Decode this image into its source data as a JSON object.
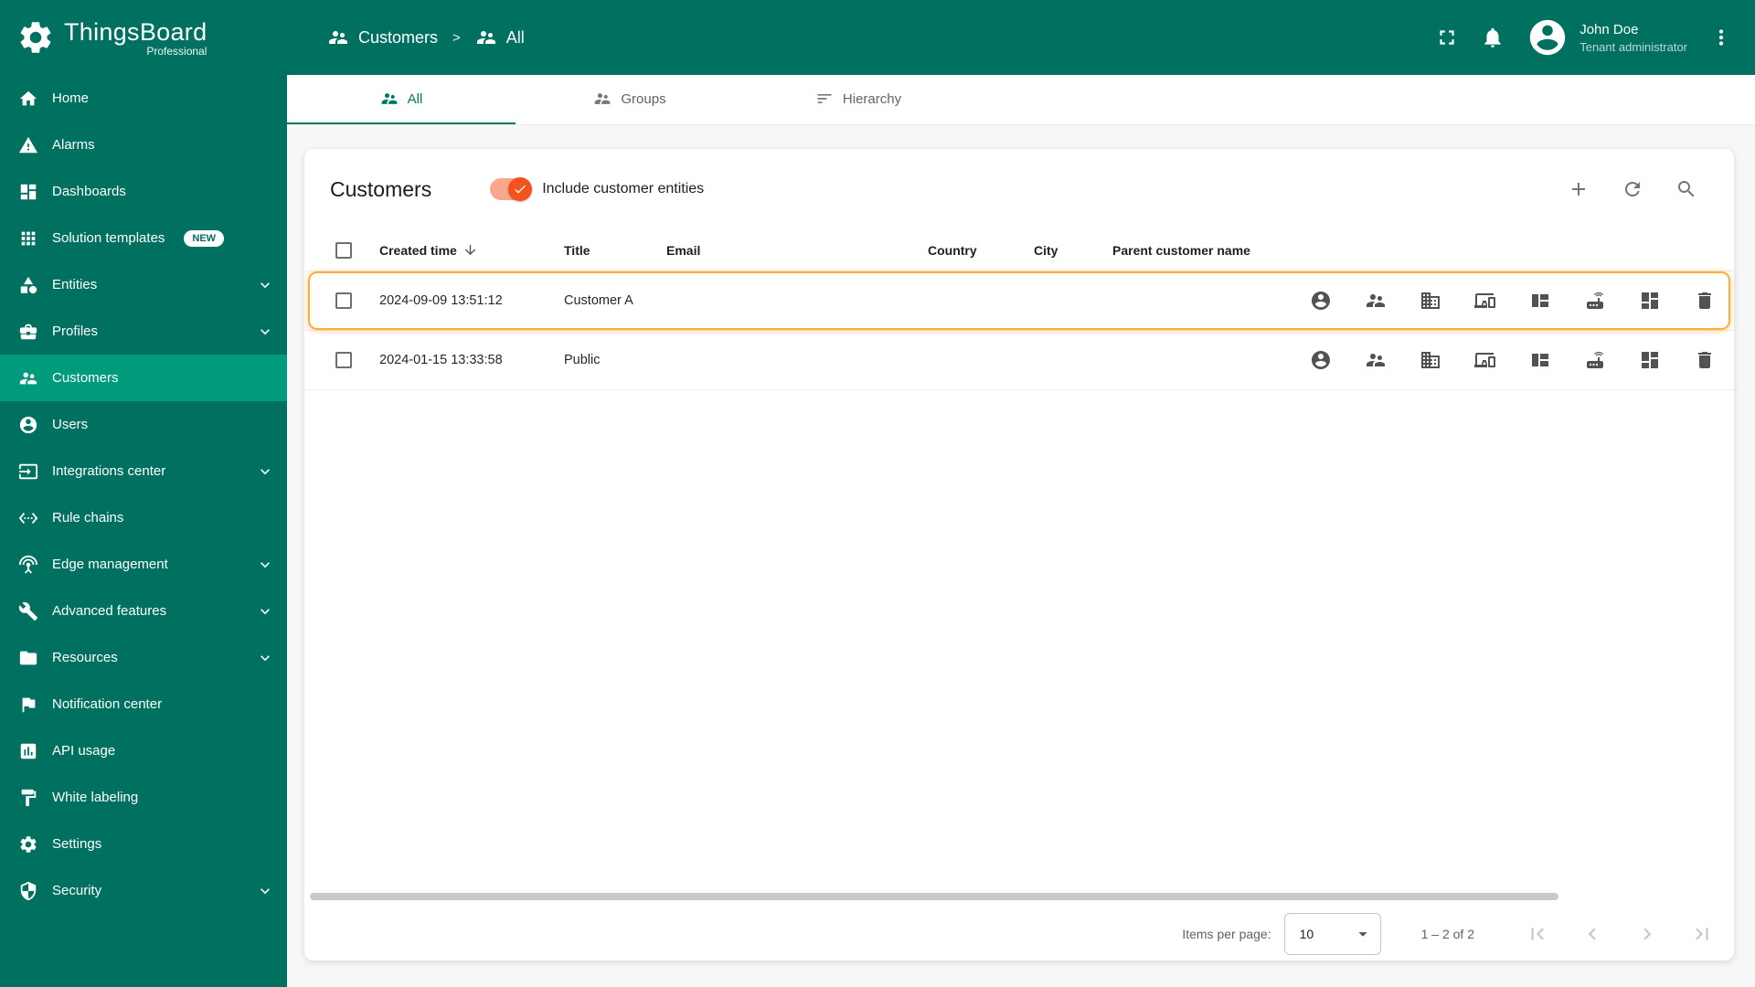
{
  "brand": {
    "name": "ThingsBoard",
    "edition": "Professional"
  },
  "topbar": {
    "breadcrumb": [
      {
        "label": "Customers",
        "icon": "customers-icon"
      },
      {
        "label": "All",
        "icon": "group-icon"
      }
    ],
    "separator": ">",
    "icons": [
      "fullscreen-icon",
      "notifications-icon",
      "avatar",
      "more-vert-icon"
    ],
    "user": {
      "name": "John Doe",
      "role": "Tenant administrator"
    }
  },
  "sidebar": {
    "items": [
      {
        "label": "Home",
        "icon": "home-icon"
      },
      {
        "label": "Alarms",
        "icon": "alarms-icon"
      },
      {
        "label": "Dashboards",
        "icon": "dashboards-icon"
      },
      {
        "label": "Solution templates",
        "icon": "solution-templates-icon",
        "badge": "NEW"
      },
      {
        "label": "Entities",
        "icon": "entities-icon",
        "expandable": true
      },
      {
        "label": "Profiles",
        "icon": "profiles-icon",
        "expandable": true
      },
      {
        "label": "Customers",
        "icon": "customers-icon",
        "active": true
      },
      {
        "label": "Users",
        "icon": "users-icon"
      },
      {
        "label": "Integrations center",
        "icon": "integrations-center-icon",
        "expandable": true
      },
      {
        "label": "Rule chains",
        "icon": "rule-chains-icon"
      },
      {
        "label": "Edge management",
        "icon": "edge-management-icon",
        "expandable": true
      },
      {
        "label": "Advanced features",
        "icon": "advanced-features-icon",
        "expandable": true
      },
      {
        "label": "Resources",
        "icon": "resources-icon",
        "expandable": true
      },
      {
        "label": "Notification center",
        "icon": "notification-center-icon"
      },
      {
        "label": "API usage",
        "icon": "api-usage-icon"
      },
      {
        "label": "White labeling",
        "icon": "white-labeling-icon"
      },
      {
        "label": "Settings",
        "icon": "settings-icon"
      },
      {
        "label": "Security",
        "icon": "security-icon",
        "expandable": true
      }
    ]
  },
  "tabs": [
    {
      "label": "All",
      "icon": "group-icon",
      "active": true
    },
    {
      "label": "Groups",
      "icon": "groups-icon",
      "active": false
    },
    {
      "label": "Hierarchy",
      "icon": "hierarchy-icon",
      "active": false
    }
  ],
  "card": {
    "title": "Customers",
    "toggle": {
      "label": "Include customer entities",
      "checked": true
    },
    "header_actions": [
      "add-icon",
      "refresh-icon",
      "search-icon"
    ],
    "columns": [
      {
        "label": "Created time",
        "sort": "desc"
      },
      {
        "label": "Title"
      },
      {
        "label": "Email"
      },
      {
        "label": "Country"
      },
      {
        "label": "City"
      },
      {
        "label": "Parent customer name"
      }
    ],
    "rows": [
      {
        "created_time": "2024-09-09 13:51:12",
        "title": "Customer A",
        "email": "",
        "country": "",
        "city": "",
        "parent_customer_name": "",
        "highlighted": true
      },
      {
        "created_time": "2024-01-15 13:33:58",
        "title": "Public",
        "email": "",
        "country": "",
        "city": "",
        "parent_customer_name": "",
        "highlighted": false
      }
    ],
    "row_actions": [
      "manage-users",
      "manage-customers",
      "manage-assets",
      "manage-devices",
      "manage-entity-views",
      "manage-edges",
      "manage-dashboards",
      "delete"
    ]
  },
  "pagination": {
    "items_per_page_label": "Items per page:",
    "items_per_page": "10",
    "range": "1 – 2 of 2"
  },
  "colors": {
    "primary": "#007061",
    "primary_active": "#009a7d",
    "accent_orange": "#f4511e",
    "highlight_border": "#ffae3c"
  }
}
